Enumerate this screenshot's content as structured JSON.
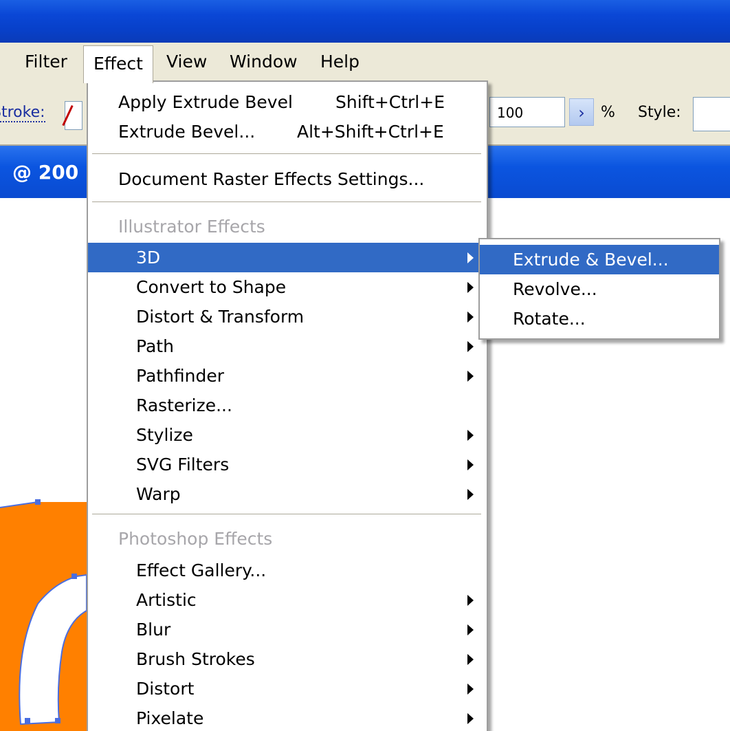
{
  "menubar": {
    "items": [
      {
        "label": "Filter"
      },
      {
        "label": "Effect"
      },
      {
        "label": "View"
      },
      {
        "label": "Window"
      },
      {
        "label": "Help"
      }
    ]
  },
  "controlbar": {
    "stroke_label": "Stroke:",
    "opacity_value": "100",
    "percent": "%",
    "style_label": "Style:"
  },
  "document": {
    "title": "@ 200"
  },
  "effect_menu": {
    "apply_last": {
      "label": "Apply Extrude  Bevel",
      "shortcut": "Shift+Ctrl+E"
    },
    "last_effect": {
      "label": "Extrude  Bevel...",
      "shortcut": "Alt+Shift+Ctrl+E"
    },
    "raster_settings": "Document Raster Effects Settings...",
    "illustrator_header": "Illustrator Effects",
    "illustrator_items": [
      {
        "label": "3D",
        "has_submenu": true
      },
      {
        "label": "Convert to Shape",
        "has_submenu": true
      },
      {
        "label": "Distort & Transform",
        "has_submenu": true
      },
      {
        "label": "Path",
        "has_submenu": true
      },
      {
        "label": "Pathfinder",
        "has_submenu": true
      },
      {
        "label": "Rasterize...",
        "has_submenu": false
      },
      {
        "label": "Stylize",
        "has_submenu": true
      },
      {
        "label": "SVG Filters",
        "has_submenu": true
      },
      {
        "label": "Warp",
        "has_submenu": true
      }
    ],
    "photoshop_header": "Photoshop Effects",
    "photoshop_items": [
      {
        "label": "Effect Gallery...",
        "has_submenu": false
      },
      {
        "label": "Artistic",
        "has_submenu": true
      },
      {
        "label": "Blur",
        "has_submenu": true
      },
      {
        "label": "Brush Strokes",
        "has_submenu": true
      },
      {
        "label": "Distort",
        "has_submenu": true
      },
      {
        "label": "Pixelate",
        "has_submenu": true
      }
    ]
  },
  "submenu_3d": {
    "items": [
      {
        "label": "Extrude & Bevel..."
      },
      {
        "label": "Revolve..."
      },
      {
        "label": "Rotate..."
      }
    ]
  },
  "colors": {
    "titlebar": "#0a47d6",
    "menubar_bg": "#ece9d8",
    "highlight": "#316ac5",
    "disabled_text": "#a7a6aa",
    "artwork_orange": "#ff8000",
    "selection_blue": "#4a6ee0"
  }
}
